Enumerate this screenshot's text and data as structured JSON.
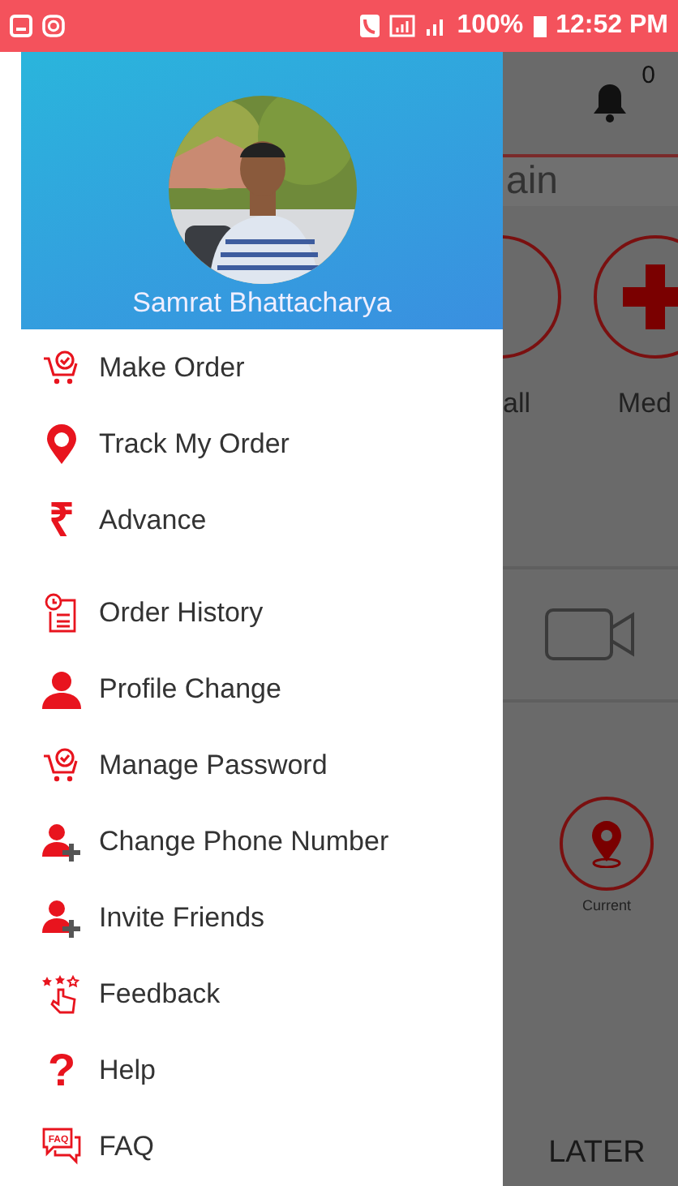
{
  "status_bar": {
    "battery": "100%",
    "time": "12:52 PM"
  },
  "drawer": {
    "user_name": "Samrat Bhattacharya",
    "items": [
      {
        "label": "Make Order",
        "kind": "cart"
      },
      {
        "label": "Track My Order",
        "kind": "pin"
      },
      {
        "label": "Advance",
        "kind": "glyph",
        "glyph": "₹"
      },
      {
        "label": "Order History",
        "kind": "history"
      },
      {
        "label": "Profile Change",
        "kind": "person"
      },
      {
        "label": "Manage Password",
        "kind": "cart"
      },
      {
        "label": "Change Phone Number",
        "kind": "person-add"
      },
      {
        "label": "Invite Friends",
        "kind": "person-add"
      },
      {
        "label": "Feedback",
        "kind": "feedback"
      },
      {
        "label": "Help",
        "kind": "glyph",
        "glyph": "?"
      },
      {
        "label": "FAQ",
        "kind": "faq",
        "icon_text": "FAQ"
      }
    ]
  },
  "background_screen": {
    "notification_count": "0",
    "search_text": "ain",
    "categories": [
      "all",
      "Med"
    ],
    "location_label": "Current",
    "later_button": "LATER"
  }
}
